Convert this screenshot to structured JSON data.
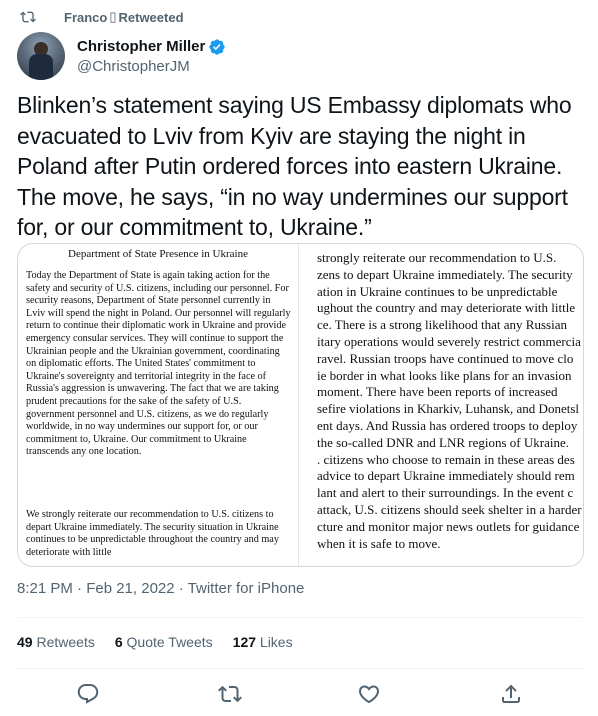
{
  "retweet_header": {
    "text_before": "Franco",
    "glyph": "▯",
    "text_after": "Retweeted"
  },
  "author": {
    "display_name": "Christopher Miller",
    "handle": "@ChristopherJM",
    "verified": true
  },
  "tweet": {
    "text": "Blinken’s statement saying US Embassy diplomats who evacuated to Lviv from Kyiv are staying the night in Poland after Putin ordered forces into eastern Ukraine. The move, he says, “in no way undermines our support for, or our commitment to, Ukraine.”"
  },
  "media": {
    "left_page": {
      "title": "Department of State Presence in Ukraine",
      "paragraph1": "Today the Department of State is again taking action for the safety and security of U.S. citizens, including our personnel. For security reasons, Department of State personnel currently in Lviv will spend the night in Poland. Our personnel will regularly return to continue their diplomatic work in Ukraine and provide emergency consular services. They will continue to support the Ukrainian people and the Ukrainian government, coordinating on diplomatic efforts. The United States' commitment to Ukraine's sovereignty and territorial integrity in the face of Russia's aggression is unwavering. The fact that we are taking prudent precautions for the sake of the safety of U.S. government personnel and U.S. citizens, as we do regularly worldwide, in no way undermines our support for, or our commitment to, Ukraine. Our commitment to Ukraine transcends any one location.",
      "paragraph2": "We strongly reiterate our recommendation to U.S. citizens to depart Ukraine immediately. The security situation in Ukraine continues to be unpredictable throughout the country and may deteriorate with little"
    },
    "right_page_lines": [
      "strongly reiterate our recommendation to U.S.",
      "zens to depart Ukraine immediately.  The security",
      "ation in Ukraine continues to be unpredictable",
      "ughout the country and may deteriorate with little",
      "ce. There is a strong likelihood that any Russian",
      "itary operations would severely restrict commercia",
      "ravel. Russian troops have continued to move clo",
      "ie border in what looks like plans for an invasion",
      " moment.  There have been reports of increased",
      "sefire violations in Kharkiv, Luhansk, and Donetsl",
      "ent days. And Russia has ordered troops to deploy",
      " the so-called DNR and LNR regions of Ukraine.",
      ". citizens who choose to remain in these areas des",
      "advice to depart Ukraine immediately should rem",
      "lant and alert to their surroundings.  In the event c",
      "attack, U.S. citizens should seek shelter in a harder",
      "cture and monitor major news outlets for guidance",
      "when it is safe to move."
    ]
  },
  "meta": {
    "timestamp": "8:21 PM · Feb 21, 2022 · Twitter for iPhone"
  },
  "stats": {
    "retweets_count": "49",
    "retweets_label": "Retweets",
    "quotes_count": "6",
    "quotes_label": "Quote Tweets",
    "likes_count": "127",
    "likes_label": "Likes"
  },
  "actions": [
    "reply-icon",
    "retweet-icon",
    "like-icon",
    "share-icon"
  ],
  "colors": {
    "verified_blue": "#1d9bf0",
    "secondary_text": "#536471",
    "divider": "#eff3f4"
  }
}
